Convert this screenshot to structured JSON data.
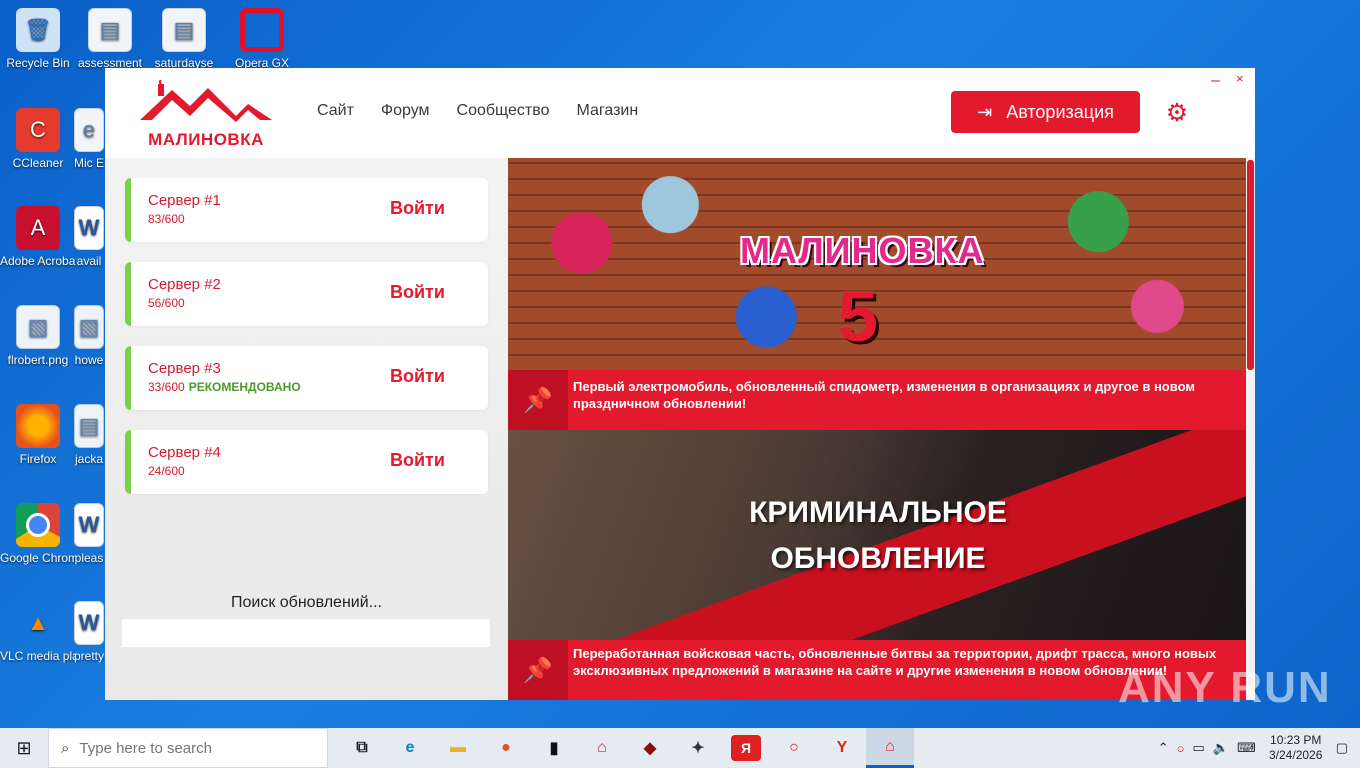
{
  "desktop": {
    "icons": [
      {
        "label": "Recycle Bin"
      },
      {
        "label": "assessment"
      },
      {
        "label": "saturdayse"
      },
      {
        "label": "Opera GX"
      },
      {
        "label": "CCleaner"
      },
      {
        "label": "Mic E"
      },
      {
        "label": "Adobe Acrobat"
      },
      {
        "label": "avail"
      },
      {
        "label": "flrobert.png"
      },
      {
        "label": "howe"
      },
      {
        "label": "Firefox"
      },
      {
        "label": "jacka"
      },
      {
        "label": "Google Chrome"
      },
      {
        "label": "pleas"
      },
      {
        "label": "VLC media player"
      },
      {
        "label": "pretty"
      }
    ]
  },
  "app": {
    "logo_text": "МАЛИНОВКА",
    "nav": [
      "Сайт",
      "Форум",
      "Сообщество",
      "Магазин"
    ],
    "auth_label": "Авторизация",
    "window_min": "–",
    "window_close": "×",
    "servers": [
      {
        "name": "Сервер #1",
        "online": "83/600",
        "tag": "",
        "join": "Войти"
      },
      {
        "name": "Сервер #2",
        "online": "56/600",
        "tag": "",
        "join": "Войти"
      },
      {
        "name": "Сервер #3",
        "online": "33/600",
        "tag": "РЕКОМЕНДОВАНО",
        "join": "Войти"
      },
      {
        "name": "Сервер #4",
        "online": "24/600",
        "tag": "",
        "join": "Войти"
      }
    ],
    "update_status": "Поиск обновлений...",
    "news": [
      {
        "banner_title": "МАЛИНОВКА",
        "banner_num": "5",
        "caption": "Первый электромобиль, обновленный спидометр, изменения в организациях и другое в новом праздничном обновлении!"
      },
      {
        "banner_title_1": "КРИМИНАЛЬНОЕ",
        "banner_title_2": "ОБНОВЛЕНИЕ",
        "caption": "Переработанная войсковая часть, обновленные битвы за территории, дрифт трасса, много новых эксклюзивных предложений в магазине на сайте и другие изменения в новом обновлении!"
      }
    ],
    "accent_color": "#e3192d",
    "online_bar_color": "#7bd04a"
  },
  "watermark": "ANY RUN",
  "taskbar": {
    "search_placeholder": "Type here to search",
    "apps": [
      "task-view",
      "edge",
      "explorer",
      "firefox",
      "app-il",
      "malinovka",
      "game",
      "app-dark",
      "yandex",
      "opera",
      "yandex-browser",
      "malinovka-active"
    ],
    "clock_time": "10:23 PM",
    "clock_date": "3/24/2026"
  }
}
